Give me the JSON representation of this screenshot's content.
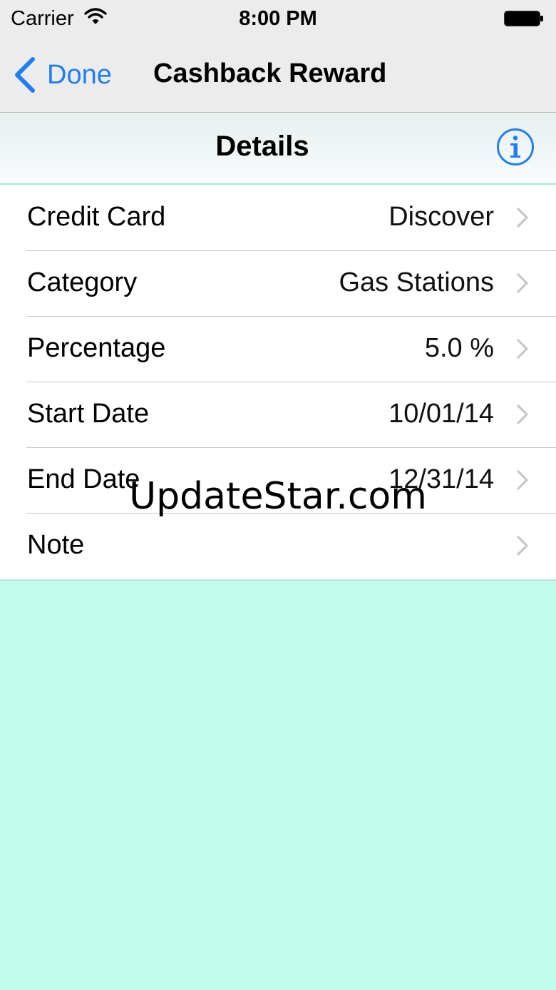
{
  "status_bar": {
    "carrier": "Carrier",
    "time": "8:00 PM",
    "wifi_icon": "wifi-icon",
    "battery_icon": "battery-icon"
  },
  "nav_bar": {
    "back_label": "Done",
    "back_icon": "chevron-left-icon",
    "title": "Cashback Reward",
    "accent_color": "#1f7ef5"
  },
  "section": {
    "title": "Details",
    "info_icon": "info-icon"
  },
  "rows": [
    {
      "label": "Credit Card",
      "value": "Discover"
    },
    {
      "label": "Category",
      "value": "Gas Stations"
    },
    {
      "label": "Percentage",
      "value": "5.0 %"
    },
    {
      "label": "Start Date",
      "value": "10/01/14"
    },
    {
      "label": "End Date",
      "value": "12/31/14"
    },
    {
      "label": "Note",
      "value": ""
    }
  ],
  "background_color": "#bffcec",
  "watermark": "UpdateStar.com"
}
